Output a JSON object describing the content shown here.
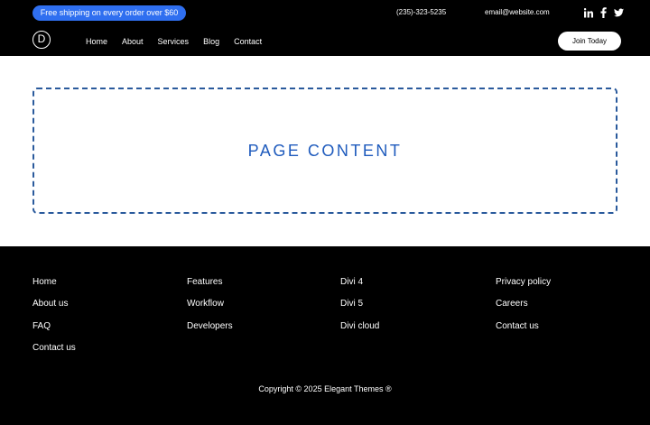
{
  "header": {
    "promo": "Free shipping on every order over $60",
    "phone": "(235)-323-5235",
    "email": "email@website.com",
    "logo_letter": "D",
    "nav": [
      "Home",
      "About",
      "Services",
      "Blog",
      "Contact"
    ],
    "join_label": "Join Today",
    "social_icons": [
      "linkedin-icon",
      "facebook-icon",
      "twitter-icon"
    ]
  },
  "main": {
    "title": "PAGE CONTENT",
    "accent_color": "#1f5bbd"
  },
  "footer": {
    "columns": [
      [
        "Home",
        "About us",
        "FAQ",
        "Contact us"
      ],
      [
        "Features",
        "Workflow",
        "Developers"
      ],
      [
        "Divi 4",
        "Divi 5",
        "Divi cloud"
      ],
      [
        "Privacy policy",
        "Careers",
        "Contact us"
      ]
    ],
    "copyright": "Copyright © 2025 Elegant Themes ®"
  },
  "colors": {
    "promo_bg": "#2f6ff0",
    "header_bg": "#000000",
    "footer_bg": "#000000"
  }
}
